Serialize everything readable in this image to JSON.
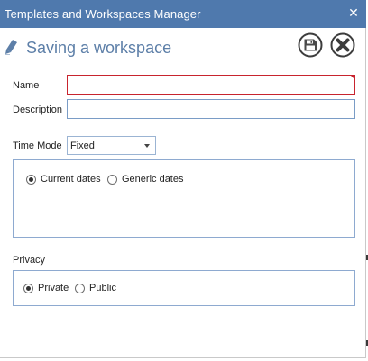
{
  "window": {
    "title": "Templates and Workspaces Manager",
    "close_glyph": "✕"
  },
  "header": {
    "heading": "Saving a workspace",
    "icons": {
      "edit": "pencil-icon",
      "save": "floppy-disk-icon",
      "cancel": "close-circle-icon"
    }
  },
  "form": {
    "name": {
      "label": "Name",
      "value": ""
    },
    "description": {
      "label": "Description",
      "value": ""
    },
    "time_mode": {
      "label": "Time Mode",
      "selected": "Fixed",
      "options": [
        {
          "label": "Current dates",
          "checked": true
        },
        {
          "label": "Generic dates",
          "checked": false
        }
      ]
    },
    "privacy": {
      "label": "Privacy",
      "options": [
        {
          "label": "Private",
          "checked": true
        },
        {
          "label": "Public",
          "checked": false
        }
      ]
    }
  },
  "colors": {
    "titlebar": "#4f79ad",
    "heading": "#5d7fa8",
    "invalid_border": "#c8242e",
    "input_border": "#7a9cc6"
  }
}
